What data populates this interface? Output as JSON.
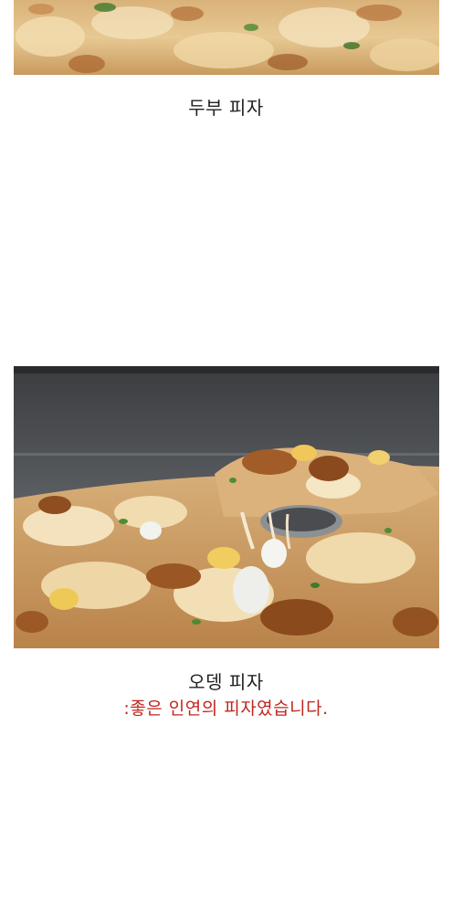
{
  "sections": [
    {
      "caption": "두부 피자"
    },
    {
      "caption": "오뎅 피자",
      "note": ":좋은 인연의 피자였습니다."
    }
  ],
  "colors": {
    "caption": "#222222",
    "note": "#c0261f"
  }
}
